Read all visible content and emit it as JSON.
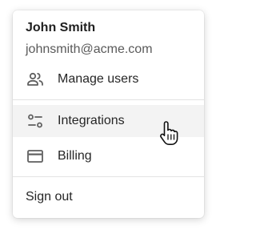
{
  "user": {
    "name": "John Smith",
    "email": "johnsmith@acme.com"
  },
  "menu": {
    "items": [
      {
        "label": "Manage users",
        "icon": "users-icon"
      },
      {
        "label": "Integrations",
        "icon": "sliders-icon"
      },
      {
        "label": "Billing",
        "icon": "credit-card-icon"
      }
    ],
    "sign_out_label": "Sign out"
  },
  "state": {
    "hovered_item": "Integrations"
  },
  "colors": {
    "icon": "#5f5f5f",
    "hover_bg": "#f3f3f3"
  }
}
